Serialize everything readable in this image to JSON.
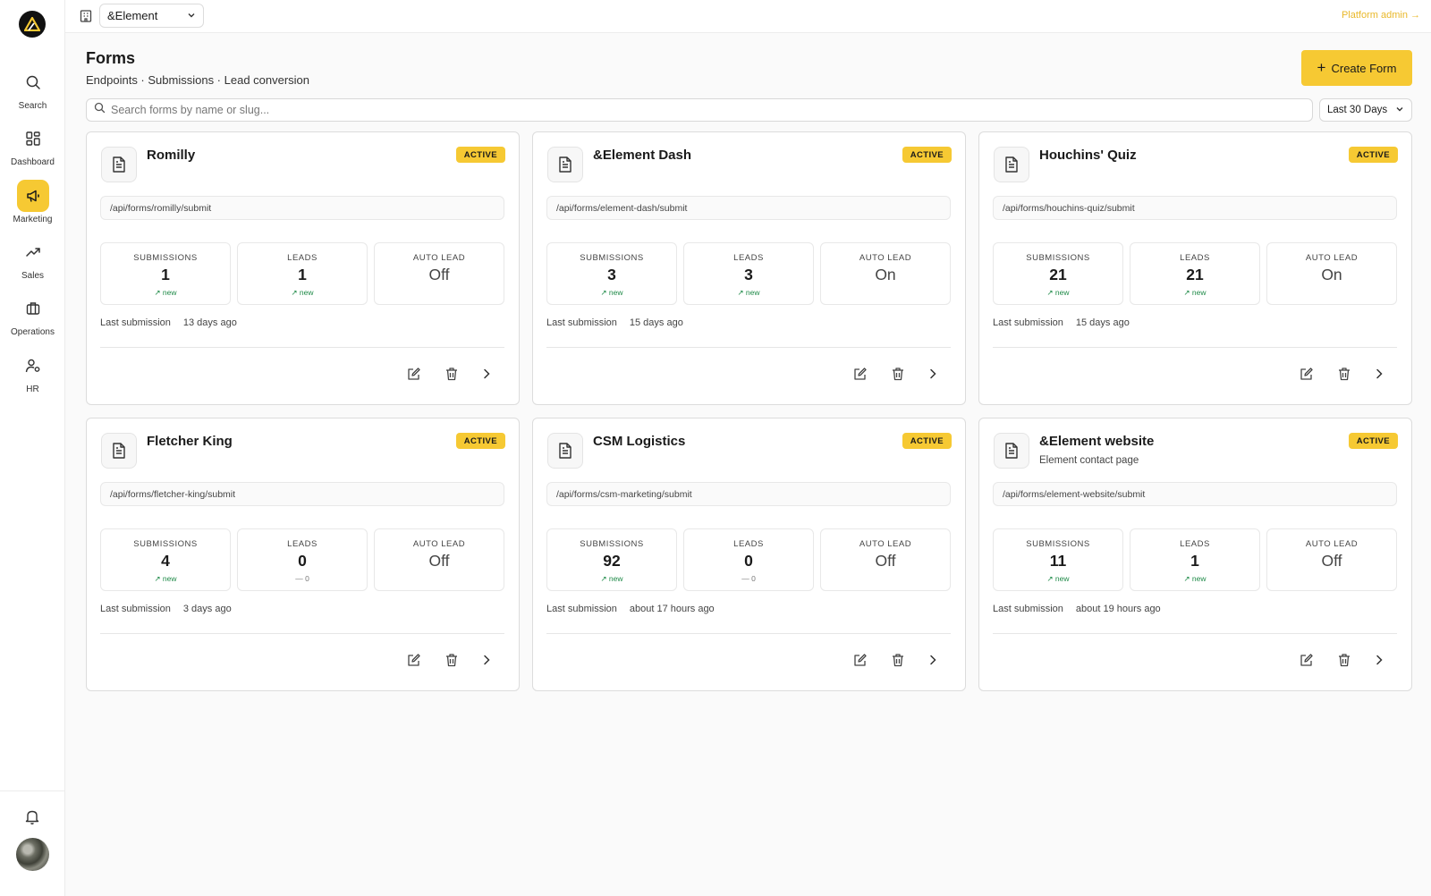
{
  "org": {
    "name": "&Element"
  },
  "platform_admin": "Platform admin →",
  "nav": [
    {
      "label": "Search",
      "icon": "search-icon"
    },
    {
      "label": "Dashboard",
      "icon": "dashboard-icon"
    },
    {
      "label": "Marketing",
      "icon": "megaphone-icon",
      "active": true
    },
    {
      "label": "Sales",
      "icon": "trending-up-icon"
    },
    {
      "label": "Operations",
      "icon": "briefcase-icon"
    },
    {
      "label": "HR",
      "icon": "user-settings-icon"
    }
  ],
  "page": {
    "title": "Forms",
    "subtitle": "Endpoints · Submissions · Lead conversion",
    "create_label": "Create Form",
    "search_placeholder": "Search forms by name or slug...",
    "range": "Last 30 Days"
  },
  "labels": {
    "submissions": "SUBMISSIONS",
    "leads": "LEADS",
    "auto_lead": "AUTO LEAD",
    "last_submission": "Last submission"
  },
  "colors": {
    "accent": "#f6c933",
    "positive": "#1f8a48",
    "link": "#e9b82a"
  },
  "cards": [
    {
      "title": "Romilly",
      "subtitle": "",
      "status": "ACTIVE",
      "endpoint": "/api/forms/romilly/submit",
      "submissions": "1",
      "submissions_delta": "↗ new",
      "leads": "1",
      "leads_delta": "↗ new",
      "auto_lead": "Off",
      "last": "13 days ago"
    },
    {
      "title": "&Element Dash",
      "subtitle": "",
      "status": "ACTIVE",
      "endpoint": "/api/forms/element-dash/submit",
      "submissions": "3",
      "submissions_delta": "↗ new",
      "leads": "3",
      "leads_delta": "↗ new",
      "auto_lead": "On",
      "last": "15 days ago"
    },
    {
      "title": "Houchins' Quiz",
      "subtitle": "",
      "status": "ACTIVE",
      "endpoint": "/api/forms/houchins-quiz/submit",
      "submissions": "21",
      "submissions_delta": "↗ new",
      "leads": "21",
      "leads_delta": "↗ new",
      "auto_lead": "On",
      "last": "15 days ago"
    },
    {
      "title": "Fletcher King",
      "subtitle": "",
      "status": "ACTIVE",
      "endpoint": "/api/forms/fletcher-king/submit",
      "submissions": "4",
      "submissions_delta": "↗ new",
      "leads": "0",
      "leads_delta": "— 0",
      "auto_lead": "Off",
      "last": "3 days ago"
    },
    {
      "title": "CSM Logistics",
      "subtitle": "",
      "status": "ACTIVE",
      "endpoint": "/api/forms/csm-marketing/submit",
      "submissions": "92",
      "submissions_delta": "↗ new",
      "leads": "0",
      "leads_delta": "— 0",
      "auto_lead": "Off",
      "last": "about 17 hours ago"
    },
    {
      "title": "&Element website",
      "subtitle": "Element contact page",
      "status": "ACTIVE",
      "endpoint": "/api/forms/element-website/submit",
      "submissions": "11",
      "submissions_delta": "↗ new",
      "leads": "1",
      "leads_delta": "↗ new",
      "auto_lead": "Off",
      "last": "about 19 hours ago"
    }
  ]
}
